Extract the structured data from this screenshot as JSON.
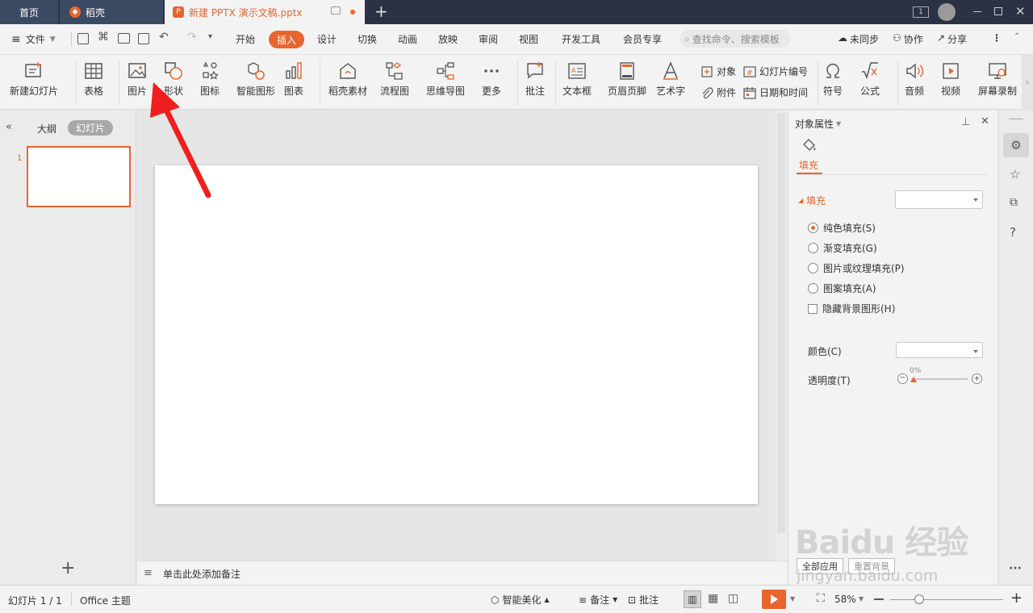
{
  "tabs": {
    "home": "首页",
    "daoke": "稻壳",
    "doc": "新建 PPTX 演示文稿.pptx"
  },
  "menu": {
    "file": "文件",
    "items": [
      "开始",
      "插入",
      "设计",
      "切换",
      "动画",
      "放映",
      "审阅",
      "视图",
      "开发工具",
      "会员专享"
    ],
    "active": "插入",
    "search_placeholder": "查找命令、搜索模板",
    "sync": "未同步",
    "collab": "协作",
    "share": "分享"
  },
  "ribbon": {
    "new_slide": "新建幻灯片",
    "table": "表格",
    "picture": "图片",
    "shape": "形状",
    "icon": "图标",
    "smart_graphic": "智能图形",
    "chart": "图表",
    "daoke_material": "稻壳素材",
    "flowchart": "流程图",
    "mindmap": "思维导图",
    "more": "更多",
    "comment": "批注",
    "textbox": "文本框",
    "header_footer": "页眉页脚",
    "art_text": "艺术字",
    "object": "对象",
    "attachment": "附件",
    "slide_number": "幻灯片编号",
    "date_time": "日期和时间",
    "symbol": "符号",
    "formula": "公式",
    "audio": "音频",
    "video": "视频",
    "screen_record": "屏幕录制"
  },
  "left_panel": {
    "outline": "大纲",
    "slides": "幻灯片",
    "slide_number": "1"
  },
  "notes_placeholder": "单击此处添加备注",
  "right_panel": {
    "title": "对象属性",
    "tab": "填充",
    "section": "填充",
    "options": [
      "纯色填充(S)",
      "渐变填充(G)",
      "图片或纹理填充(P)",
      "图案填充(A)"
    ],
    "selected": "纯色填充(S)",
    "hide_bg": "隐藏背景图形(H)",
    "color_label": "颜色(C)",
    "transparency_label": "透明度(T)",
    "transparency_value": "0%",
    "apply_all": "全部应用",
    "reset_bg": "重置背景"
  },
  "status": {
    "slide_info": "幻灯片 1 / 1",
    "theme": "Office 主题",
    "smart_beautify": "智能美化",
    "notes": "备注",
    "comments": "批注",
    "zoom": "58%"
  },
  "watermark": {
    "brand": "Baidu 经验",
    "url": "jingyan.baidu.com"
  },
  "colors": {
    "accent": "#e8652f",
    "titlebar": "#2a3244",
    "tab_inactive": "#3b4a63"
  }
}
